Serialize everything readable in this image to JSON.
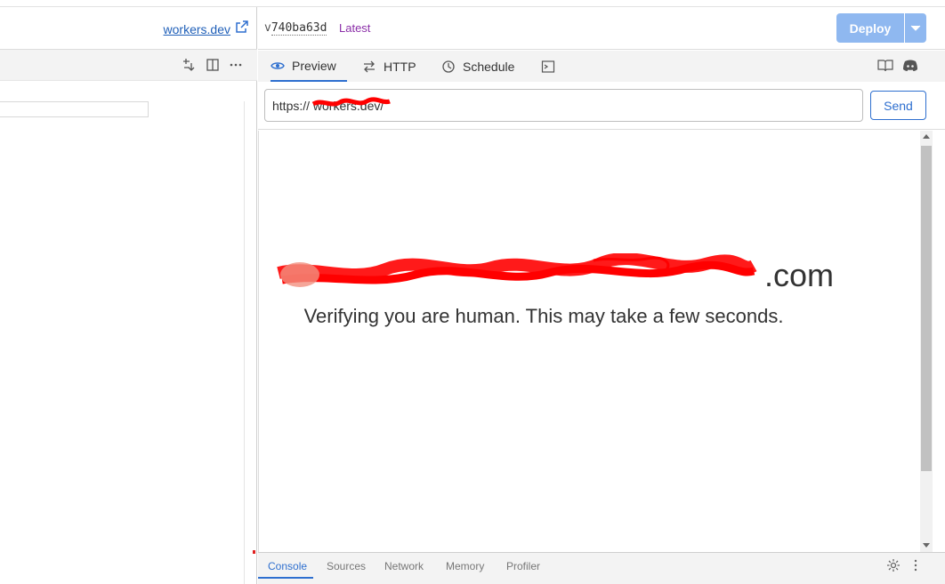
{
  "left": {
    "link_text": "workers.dev",
    "toolbar_icons": [
      "diff-icon",
      "split-view-icon",
      "more-icon"
    ]
  },
  "header": {
    "version_prefix": "v",
    "version_hash": "740ba63d",
    "latest_label": "Latest",
    "deploy_label": "Deploy"
  },
  "tabs": [
    {
      "label": "Preview",
      "icon": "eye-icon",
      "active": true
    },
    {
      "label": "HTTP",
      "icon": "swap-arrows-icon",
      "active": false
    },
    {
      "label": "Schedule",
      "icon": "clock-icon",
      "active": false
    },
    {
      "label": "",
      "icon": "terminal-icon",
      "active": false
    }
  ],
  "tab_right_icons": [
    "docs-book-icon",
    "discord-icon"
  ],
  "urlbar": {
    "value": "https://              workers.dev/",
    "send_label": "Send"
  },
  "preview": {
    "domain_suffix": ".com",
    "message": "Verifying you are human. This may take a few seconds."
  },
  "devtools": {
    "tabs": [
      "Console",
      "Sources",
      "Network",
      "Memory",
      "Profiler"
    ],
    "active": "Console"
  },
  "colors": {
    "accent": "#2e6fcf",
    "deploy_bg": "#8fb8f0",
    "latest": "#8b2fa8",
    "redaction": "#ff0000"
  }
}
